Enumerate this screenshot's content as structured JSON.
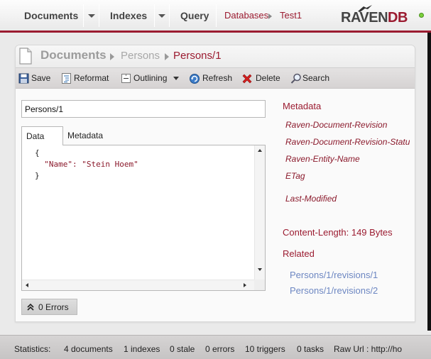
{
  "nav": {
    "documents": "Documents",
    "indexes": "Indexes",
    "query": "Query",
    "crumb_databases": "Databases",
    "crumb_db": "Test1",
    "logo_main": "RAVEN",
    "logo_accent": "DB"
  },
  "header": {
    "title": "Documents",
    "collection": "Persons",
    "current": "Persons/1"
  },
  "toolbar": {
    "save": "Save",
    "reformat": "Reformat",
    "outlining": "Outlining",
    "refresh": "Refresh",
    "delete": "Delete",
    "search": "Search"
  },
  "editor": {
    "document_id": "Persons/1",
    "tabs": [
      "Data",
      "Metadata"
    ],
    "lines": [
      "{",
      "  \"Name\": \"Stein Hoem\"",
      "}"
    ]
  },
  "errors": {
    "label": "0 Errors"
  },
  "metadata": {
    "title": "Metadata",
    "keys": [
      "Raven-Document-Revision",
      "Raven-Document-Revision-Status",
      "Raven-Entity-Name",
      "ETag",
      "Last-Modified"
    ],
    "content_length": "Content-Length: 149 Bytes"
  },
  "related": {
    "title": "Related",
    "links": [
      "Persons/1/revisions/1",
      "Persons/1/revisions/2"
    ]
  },
  "statusbar": {
    "label": "Statistics:",
    "documents": "4 documents",
    "indexes": "1 indexes",
    "stale": "0 stale",
    "errors": "0 errors",
    "triggers": "10 triggers",
    "tasks": "0 tasks",
    "raw_url": "Raw Url : http://ho"
  },
  "colors": {
    "accent": "#9b1b30",
    "link": "#6d87c2",
    "status_ok": "#7ad13b"
  }
}
